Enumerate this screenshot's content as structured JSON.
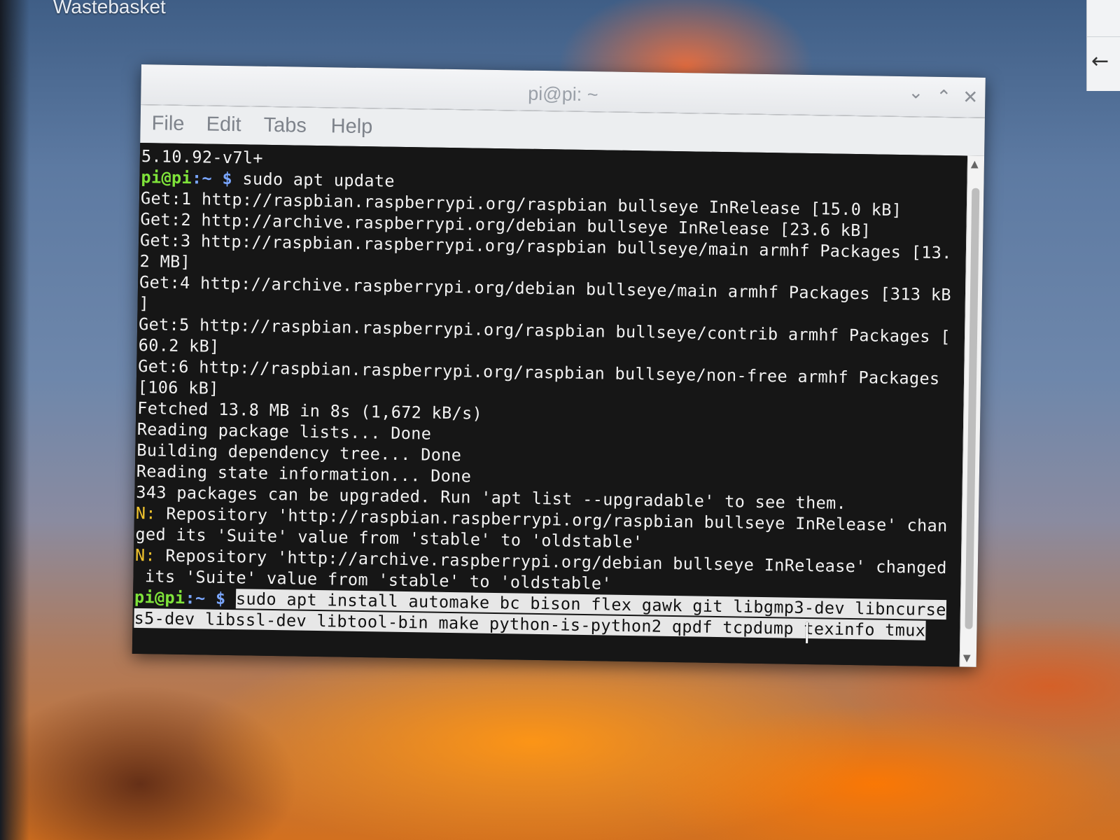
{
  "desktop": {
    "wastebasket_label": "Wastebasket",
    "right_panel_icon": "back-arrow-icon"
  },
  "window": {
    "title": "pi@pi: ~",
    "controls": {
      "minimize_glyph": "⌄",
      "maximize_glyph": "⌃",
      "close_glyph": "✕"
    }
  },
  "menu": {
    "file": "File",
    "edit": "Edit",
    "tabs": "Tabs",
    "help": "Help"
  },
  "terminal": {
    "prompt_user": "pi@pi",
    "prompt_path": ":~ $",
    "lines": {
      "l0": "5.10.92-v7l+",
      "l1_cmd": " sudo apt update",
      "l2": "Get:1 http://raspbian.raspberrypi.org/raspbian bullseye InRelease [15.0 kB]",
      "l3": "Get:2 http://archive.raspberrypi.org/debian bullseye InRelease [23.6 kB]",
      "l4": "Get:3 http://raspbian.raspberrypi.org/raspbian bullseye/main armhf Packages [13.",
      "l5": "2 MB]",
      "l6": "Get:4 http://archive.raspberrypi.org/debian bullseye/main armhf Packages [313 kB",
      "l7": "]",
      "l8": "Get:5 http://raspbian.raspberrypi.org/raspbian bullseye/contrib armhf Packages [",
      "l9": "60.2 kB]",
      "l10": "Get:6 http://raspbian.raspberrypi.org/raspbian bullseye/non-free armhf Packages",
      "l11": "[106 kB]",
      "l12": "Fetched 13.8 MB in 8s (1,672 kB/s)",
      "l13": "Reading package lists... Done",
      "l14": "Building dependency tree... Done",
      "l15": "Reading state information... Done",
      "l16": "343 packages can be upgraded. Run 'apt list --upgradable' to see them.",
      "l17_prefix": "N:",
      "l17": " Repository 'http://raspbian.raspberrypi.org/raspbian bullseye InRelease' chan",
      "l18": "ged its 'Suite' value from 'stable' to 'oldstable'",
      "l19_prefix": "N:",
      "l19": " Repository 'http://archive.raspberrypi.org/debian bullseye InRelease' changed",
      "l20": " its 'Suite' value from 'stable' to 'oldstable'",
      "l21_cmd": "sudo apt install automake bc bison flex gawk git libgmp3-dev libncurse",
      "l22_cmd": "s5-dev libssl-dev libtool-bin make python-is-python2 qpdf tcpdump texinfo tmux"
    }
  },
  "colors": {
    "prompt_user": "#7fe33a",
    "prompt_path": "#7aa6ff",
    "notice": "#f0c32e",
    "terminal_bg": "#161616"
  }
}
